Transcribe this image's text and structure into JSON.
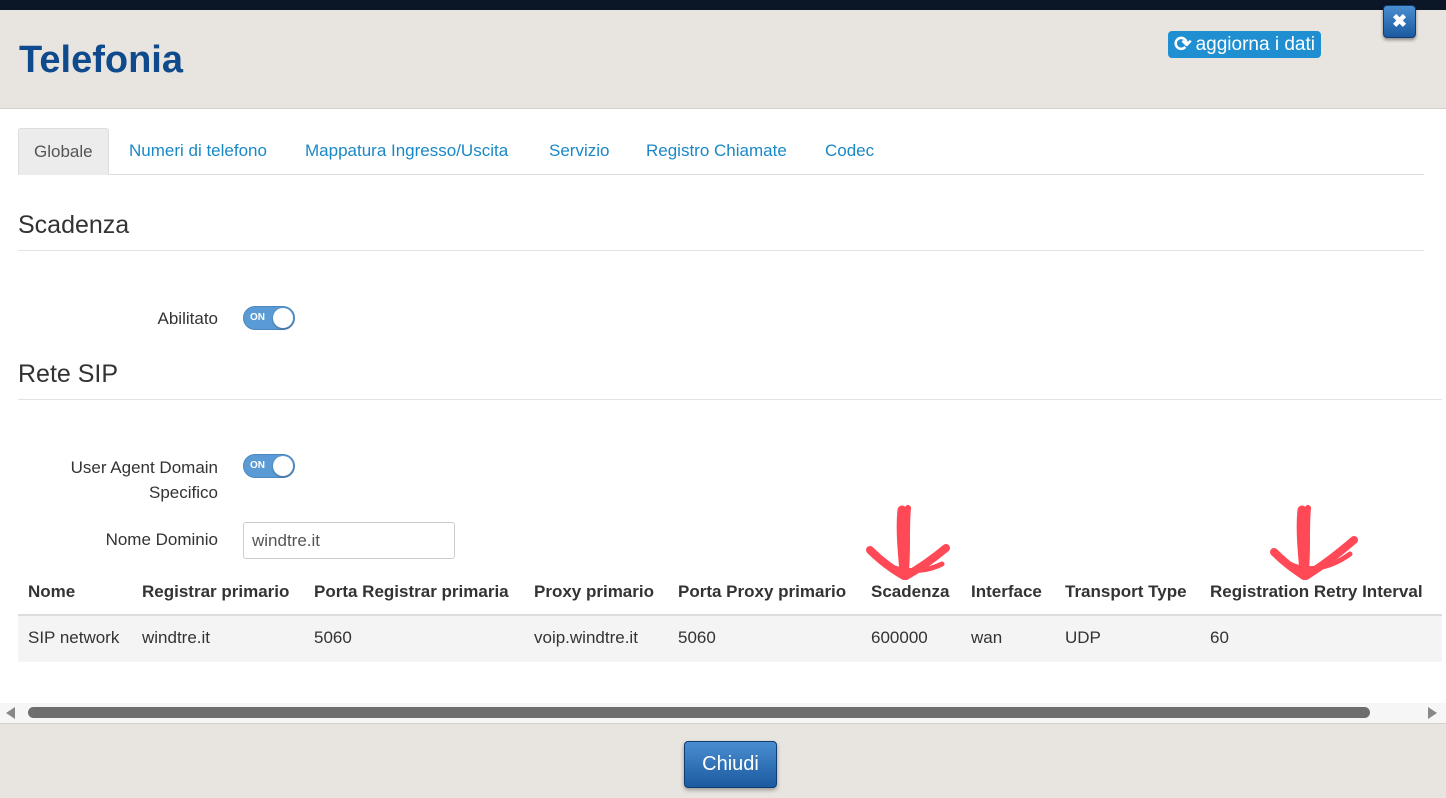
{
  "header": {
    "title": "Telefonia",
    "refresh_label": "aggiorna i dati",
    "refresh_icon": "refresh-icon",
    "close_icon": "close-icon",
    "close_symbol": "✖"
  },
  "tabs": [
    {
      "label": "Globale",
      "active": true
    },
    {
      "label": "Numeri di telefono",
      "active": false
    },
    {
      "label": "Mappatura Ingresso/Uscita",
      "active": false
    },
    {
      "label": "Servizio",
      "active": false
    },
    {
      "label": "Registro Chiamate",
      "active": false
    },
    {
      "label": "Codec",
      "active": false
    }
  ],
  "scadenza_section": {
    "title": "Scadenza",
    "enabled_label": "Abilitato",
    "enabled_toggle": "ON"
  },
  "sip_section": {
    "title": "Rete SIP",
    "ua_label_line1": "User Agent Domain",
    "ua_label_line2": "Specifico",
    "ua_toggle": "ON",
    "domain_label": "Nome Dominio",
    "domain_value": "windtre.it"
  },
  "table": {
    "headers": [
      "Nome",
      "Registrar primario",
      "Porta Registrar primaria",
      "Proxy primario",
      "Porta Proxy primario",
      "Scadenza",
      "Interface",
      "Transport Type",
      "Registration Retry Interval"
    ],
    "rows": [
      [
        "SIP network",
        "windtre.it",
        "5060",
        "voip.windtre.it",
        "5060",
        "600000",
        "wan",
        "UDP",
        "60"
      ]
    ]
  },
  "footer": {
    "close_label": "Chiudi"
  },
  "colors": {
    "title": "#0e4a8c",
    "link": "#1a88c6",
    "toggle_on": "#5b9bd5",
    "button": "#1b5aa0",
    "annotation": "#ff2a3a"
  }
}
